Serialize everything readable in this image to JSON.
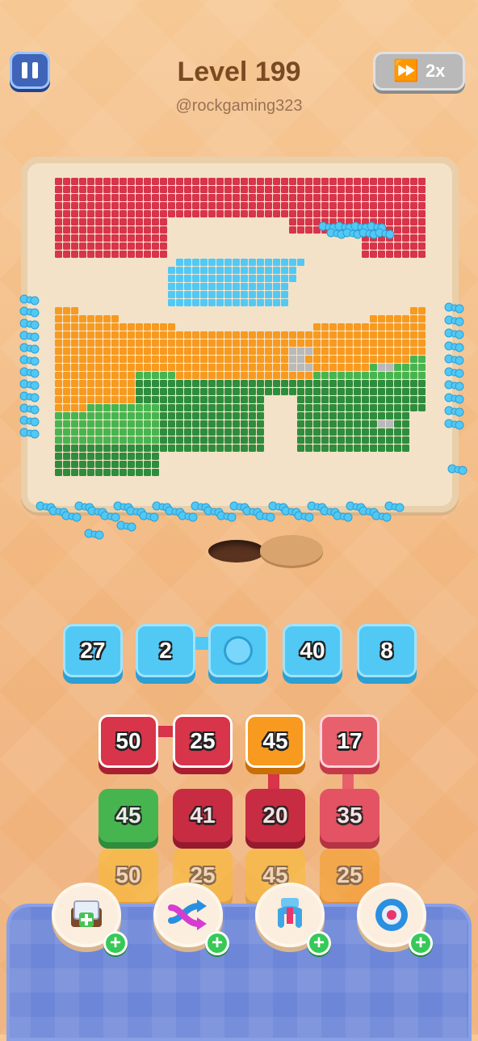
{
  "header": {
    "level_title": "Level 199",
    "username": "@rockgaming323",
    "speed_label": "2x"
  },
  "icons": {
    "pause": "pause-icon",
    "fast_forward": "fast-forward-icon",
    "boosters": [
      "add-box-booster-icon",
      "shuffle-arrows-booster-icon",
      "magnet-claw-booster-icon",
      "donut-ring-booster-icon"
    ]
  },
  "colors": {
    "red": "#d8344a",
    "cyan": "#52c8f5",
    "orange": "#f79a1f",
    "yellow": "#fbbb2a",
    "green": "#47b54f",
    "dark_green": "#2e8d3d",
    "grey": "#b9b9b9",
    "board": "#f3e2c8"
  },
  "queue": [
    {
      "value": "27",
      "color": "cyan"
    },
    {
      "value": "2",
      "color": "cyan"
    },
    {
      "value": "",
      "color": "cyan"
    },
    {
      "value": "40",
      "color": "cyan"
    },
    {
      "value": "8",
      "color": "cyan"
    }
  ],
  "grid": {
    "row1": [
      {
        "value": "50",
        "color": "red"
      },
      {
        "value": "25",
        "color": "red"
      },
      {
        "value": "45",
        "color": "orange"
      },
      {
        "value": "17",
        "color": "red"
      }
    ],
    "row2": [
      {
        "value": "45",
        "color": "green"
      },
      {
        "value": "41",
        "color": "red"
      },
      {
        "value": "20",
        "color": "red"
      },
      {
        "value": "35",
        "color": "red"
      }
    ],
    "row3": [
      {
        "value": "50",
        "color": "yellow"
      },
      {
        "value": "25",
        "color": "yellow"
      },
      {
        "value": "45",
        "color": "yellow"
      },
      {
        "value": "25",
        "color": "orange"
      }
    ]
  },
  "booster_badge": "+"
}
